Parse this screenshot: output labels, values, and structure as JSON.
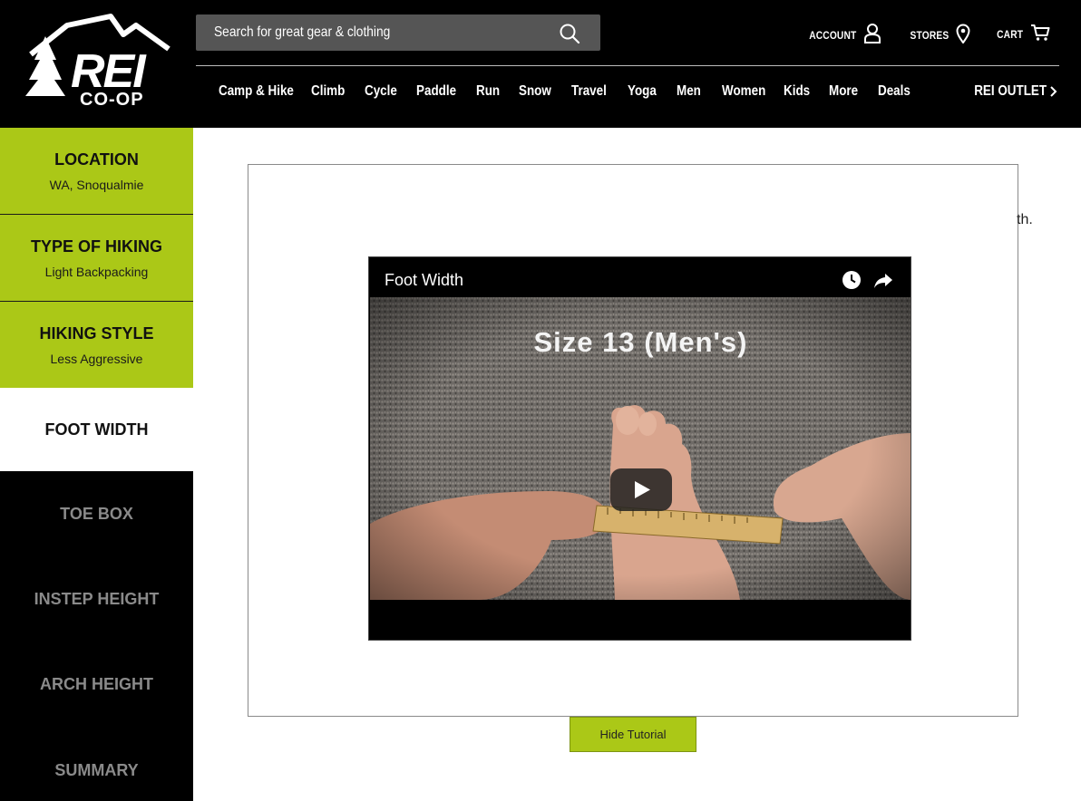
{
  "header": {
    "logo_text_top": "REI",
    "logo_text_bottom": "CO-OP",
    "search_placeholder": "Search for great gear & clothing",
    "account_label": "ACCOUNT",
    "stores_label": "STORES",
    "cart_label": "CART",
    "outlet_label": "REI OUTLET",
    "nav": [
      "Camp & Hike",
      "Climb",
      "Cycle",
      "Paddle",
      "Run",
      "Snow",
      "Travel",
      "Yoga",
      "Men",
      "Women",
      "Kids",
      "More",
      "Deals"
    ]
  },
  "sidebar": {
    "steps": [
      {
        "title": "LOCATION",
        "sub": "WA, Snoqualmie",
        "state": "done"
      },
      {
        "title": "TYPE OF HIKING",
        "sub": "Light Backpacking",
        "state": "done"
      },
      {
        "title": "HIKING STYLE",
        "sub": "Less Aggressive",
        "state": "done"
      },
      {
        "title": "FOOT WIDTH",
        "sub": "",
        "state": "current"
      },
      {
        "title": "TOE BOX",
        "sub": "",
        "state": "pending"
      },
      {
        "title": "INSTEP HEIGHT",
        "sub": "",
        "state": "pending"
      },
      {
        "title": "ARCH HEIGHT",
        "sub": "",
        "state": "pending"
      },
      {
        "title": "SUMMARY",
        "sub": "",
        "state": "pending"
      }
    ]
  },
  "main": {
    "stray_text": "th.",
    "video_title": "Foot Width",
    "video_overlay": "Size 13 (Men's)",
    "hide_button": "Hide Tutorial"
  },
  "colors": {
    "accent_green": "#abc817",
    "header_bg": "#000000",
    "search_bg": "#555555"
  },
  "icons": [
    "search-icon",
    "account-icon",
    "stores-pin-icon",
    "cart-icon",
    "chevron-right-icon",
    "watch-later-icon",
    "share-icon",
    "play-icon"
  ]
}
